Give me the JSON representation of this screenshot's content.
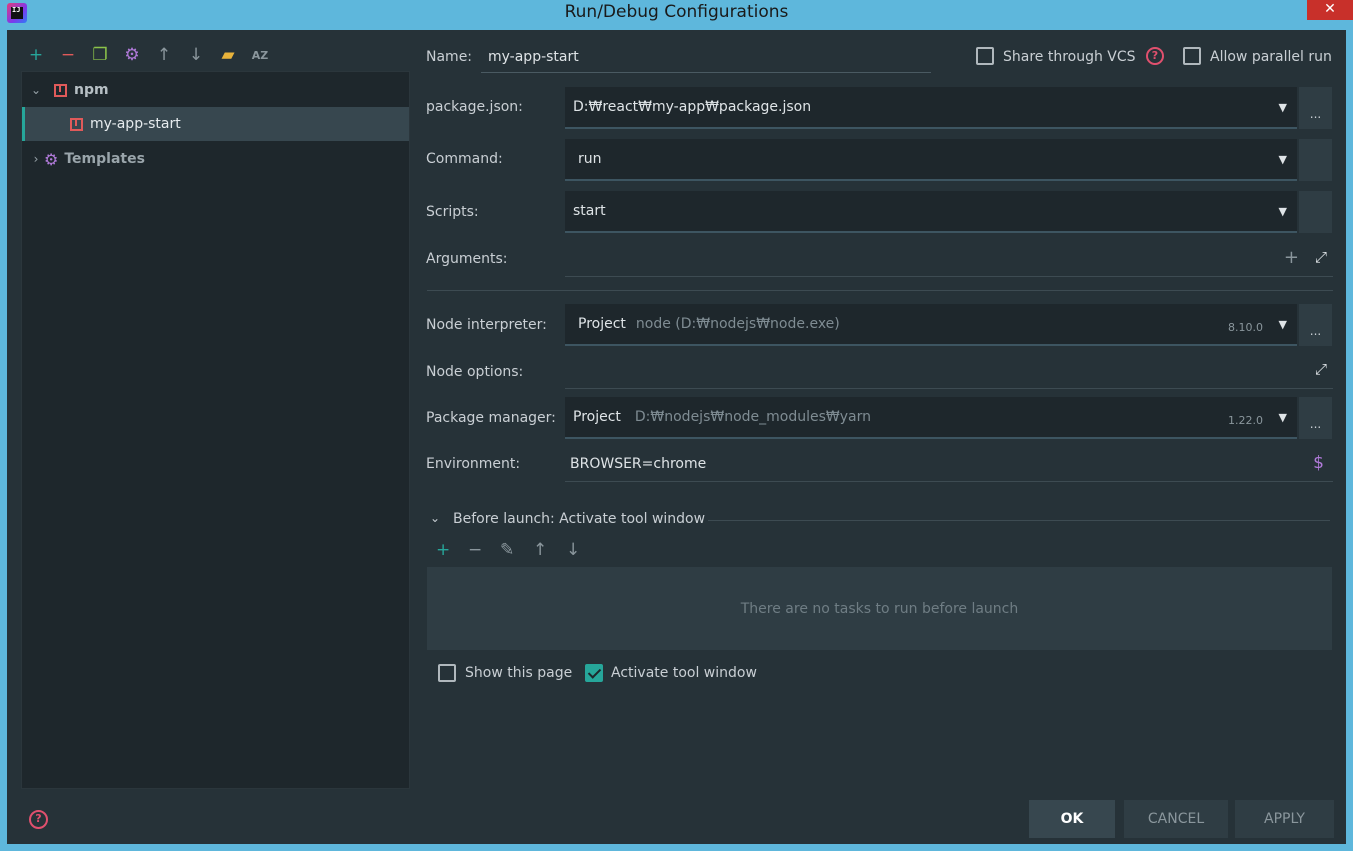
{
  "window": {
    "title": "Run/Debug Configurations",
    "close": "✕",
    "app_icon_text": "IJ"
  },
  "left_toolbar": [
    {
      "name": "add",
      "glyph": "+",
      "color": "#26a69a"
    },
    {
      "name": "remove",
      "glyph": "−",
      "color": "#e05a5a"
    },
    {
      "name": "copy",
      "glyph": "❐",
      "color": "#8bc34a"
    },
    {
      "name": "settings",
      "glyph": "⚙",
      "color": "#b07ad9"
    },
    {
      "name": "move-up",
      "glyph": "↑",
      "color": "#8a969c"
    },
    {
      "name": "move-down",
      "glyph": "↓",
      "color": "#8a969c"
    },
    {
      "name": "folder",
      "glyph": "▰",
      "color": "#e8b33b"
    },
    {
      "name": "sort",
      "glyph": "AZ",
      "color": "#8a969c"
    }
  ],
  "tree": {
    "npm": "npm",
    "item": "my-app-start",
    "templates": "Templates"
  },
  "form": {
    "name_label": "Name:",
    "name_value": "my-app-start",
    "share_vcs": "Share through VCS",
    "allow_parallel": "Allow parallel run",
    "package_json_label": "package.json:",
    "package_json_value": "D:₩react₩my-app₩package.json",
    "command_label": "Command:",
    "command_value": "run",
    "scripts_label": "Scripts:",
    "scripts_value": "start",
    "arguments_label": "Arguments:",
    "node_interpreter_label": "Node interpreter:",
    "node_interpreter_project": "Project",
    "node_interpreter_path": "node (D:₩nodejs₩node.exe)",
    "node_version": "8.10.0",
    "node_options_label": "Node options:",
    "package_manager_label": "Package manager:",
    "package_manager_project": "Project",
    "package_manager_path": "D:₩nodejs₩node_modules₩yarn",
    "package_manager_version": "1.22.0",
    "environment_label": "Environment:",
    "environment_value": "BROWSER=chrome",
    "dots": "...",
    "dollar": "$"
  },
  "before_launch": {
    "header": "Before launch: Activate tool window",
    "empty": "There are no tasks to run before launch",
    "show_page": "Show this page",
    "activate_tool": "Activate tool window"
  },
  "buttons": {
    "ok": "OK",
    "cancel": "CANCEL",
    "apply": "APPLY"
  },
  "colors": {
    "accent": "#26a69a",
    "bg": "#263238",
    "danger": "#e05a5a"
  }
}
